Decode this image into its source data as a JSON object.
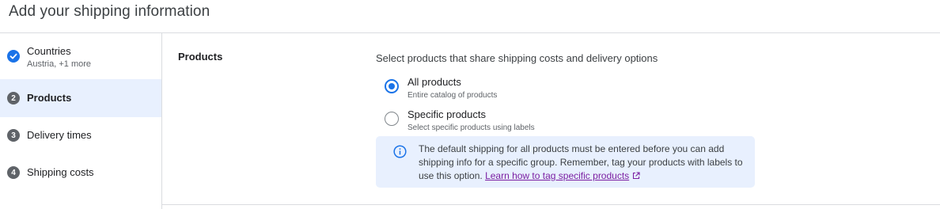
{
  "page": {
    "title": "Add your shipping information"
  },
  "stepper": {
    "steps": [
      {
        "badge": "✓",
        "label": "Countries",
        "sublabel": "Austria, +1 more",
        "state": "done"
      },
      {
        "badge": "2",
        "label": "Products",
        "state": "active"
      },
      {
        "badge": "3",
        "label": "Delivery times",
        "state": "pending"
      },
      {
        "badge": "4",
        "label": "Shipping costs",
        "state": "pending"
      }
    ]
  },
  "products": {
    "section_title": "Products",
    "question": "Select products that share shipping costs and delivery options",
    "options": [
      {
        "label": "All products",
        "sublabel": "Entire catalog of products",
        "checked": true
      },
      {
        "label": "Specific products",
        "sublabel": "Select specific products using labels",
        "checked": false
      }
    ],
    "info": {
      "text": "The default shipping for all products must be entered before you can add shipping info for a specific group. Remember, tag your products with labels to use this option.",
      "link_text": "Learn how to tag specific products"
    }
  },
  "colors": {
    "accent": "#1a73e8",
    "active_step_bg": "#e8f0fe",
    "info_bg": "#e8f0fe",
    "link": "#7b1fa2"
  },
  "icons": {
    "step_done": "check-icon",
    "info": "info-icon",
    "external_link": "external-link-icon"
  }
}
